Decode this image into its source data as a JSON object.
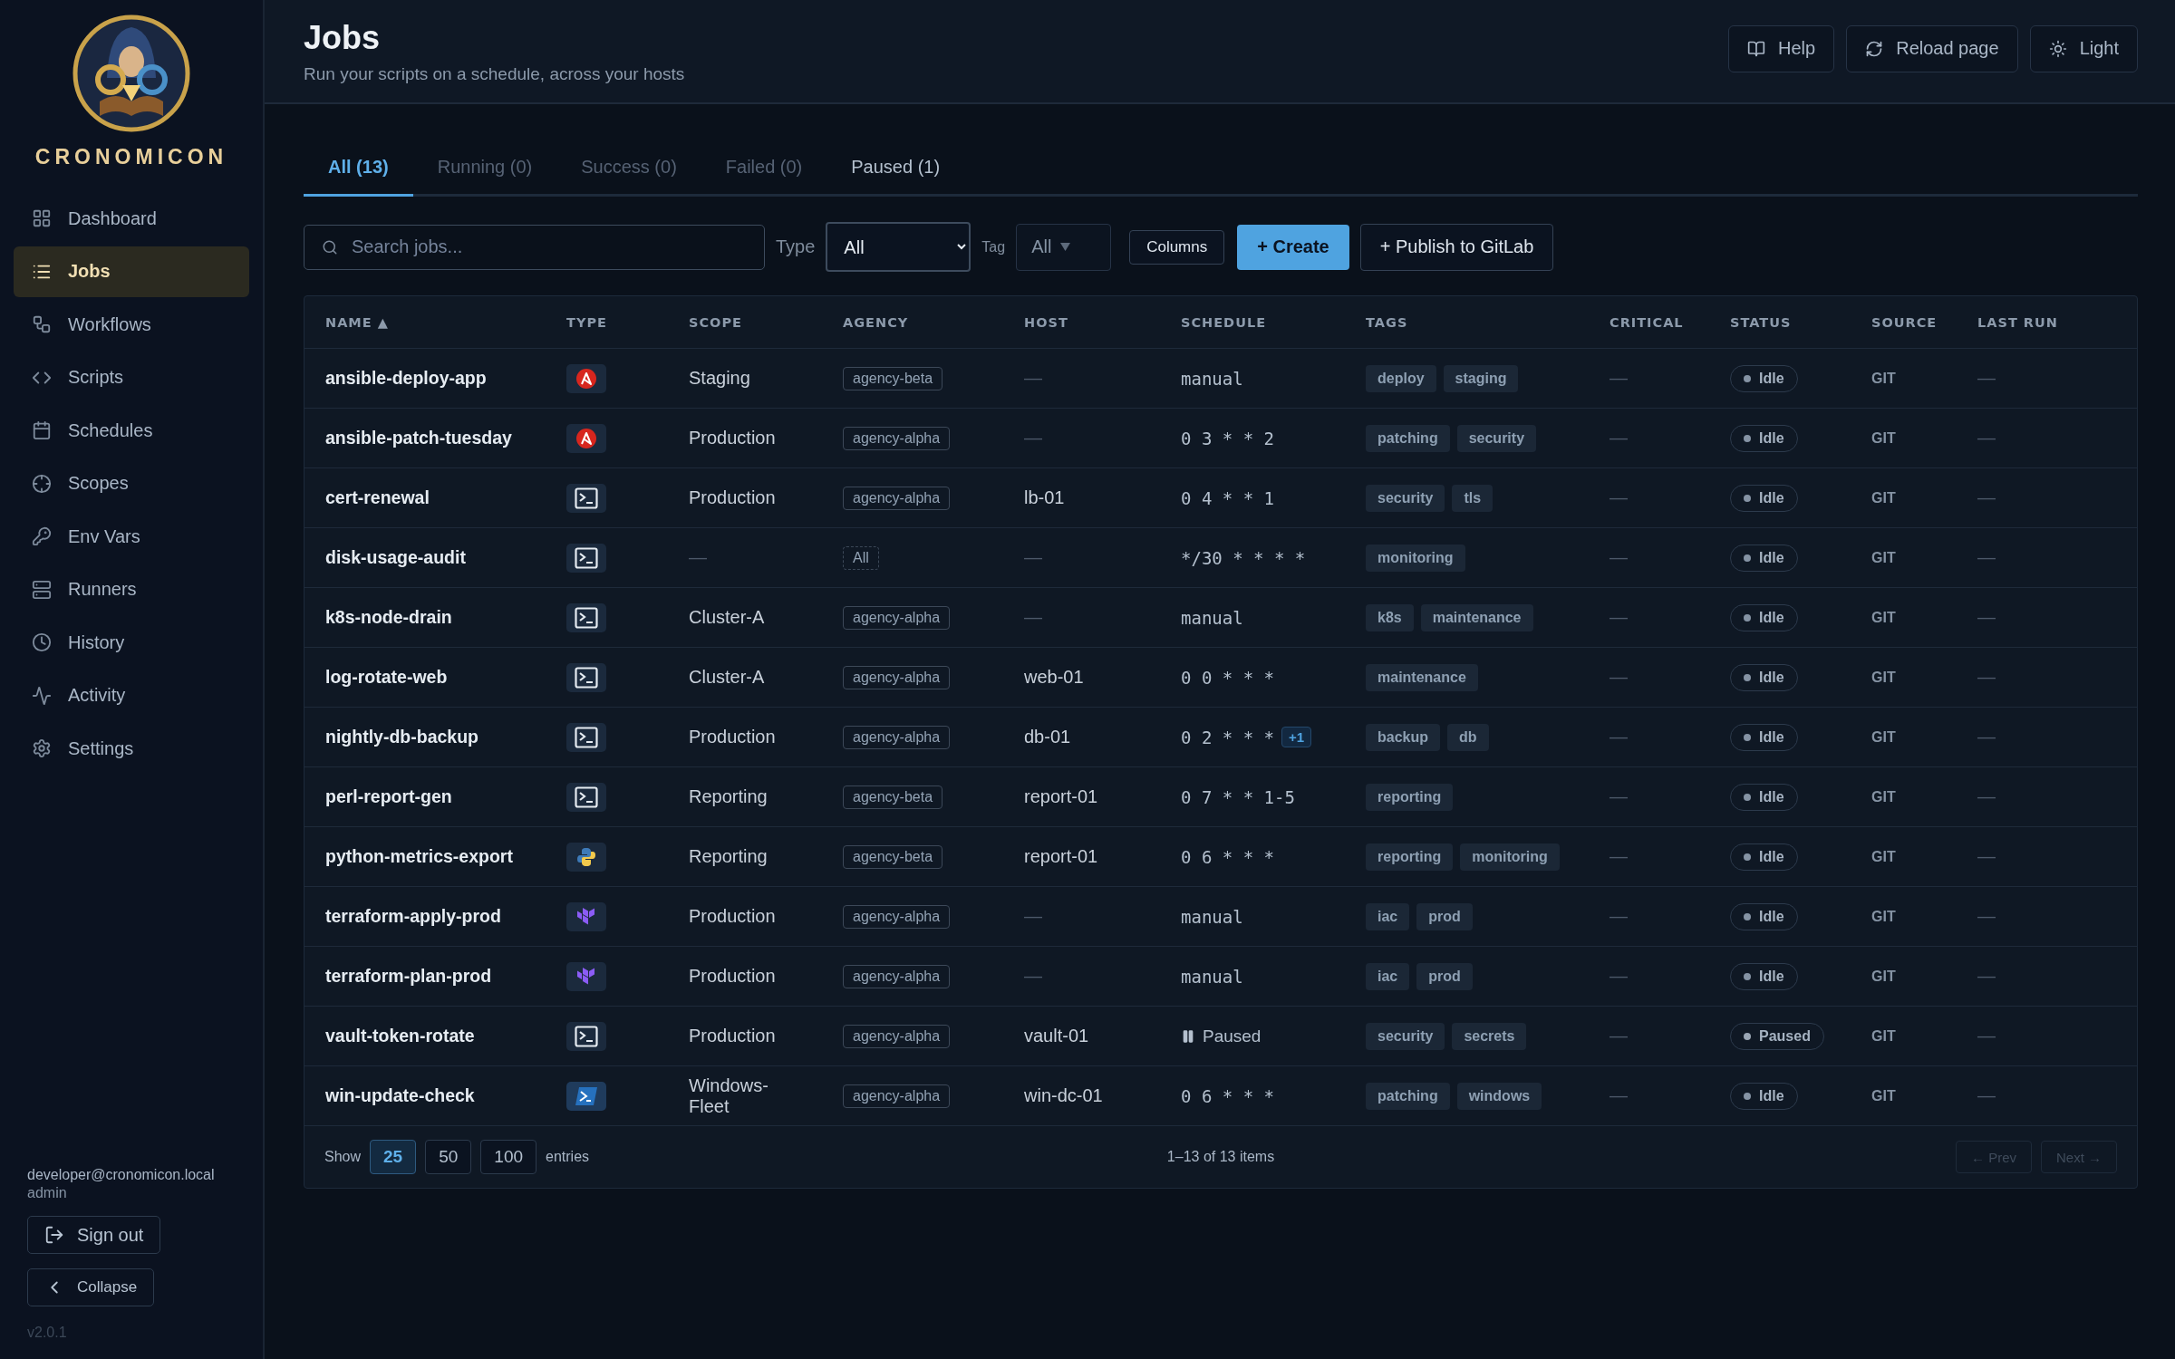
{
  "sidebar": {
    "brand": "CRONOMICON",
    "items": [
      {
        "label": "Dashboard",
        "selected": false
      },
      {
        "label": "Jobs",
        "selected": true
      },
      {
        "label": "Workflows",
        "selected": false
      },
      {
        "label": "Scripts",
        "selected": false
      },
      {
        "label": "Schedules",
        "selected": false
      },
      {
        "label": "Scopes",
        "selected": false
      },
      {
        "label": "Env Vars",
        "selected": false
      },
      {
        "label": "Runners",
        "selected": false
      },
      {
        "label": "History",
        "selected": false
      },
      {
        "label": "Activity",
        "selected": false
      },
      {
        "label": "Settings",
        "selected": false
      }
    ],
    "user": {
      "email": "developer@cronomicon.local",
      "role": "admin"
    },
    "sign_out": "Sign out",
    "collapse": "Collapse",
    "version": "v2.0.1"
  },
  "header": {
    "title": "Jobs",
    "subtitle": "Run your scripts on a schedule, across your hosts",
    "buttons": [
      "Help",
      "Reload page",
      "Light"
    ]
  },
  "tabs": [
    {
      "label": "All (13)",
      "selected": true,
      "disabled": false
    },
    {
      "label": "Running (0)",
      "selected": false,
      "disabled": true
    },
    {
      "label": "Success (0)",
      "selected": false,
      "disabled": true
    },
    {
      "label": "Failed (0)",
      "selected": false,
      "disabled": true
    },
    {
      "label": "Paused (1)",
      "selected": false,
      "disabled": false
    }
  ],
  "filters": {
    "search_placeholder": "Search jobs...",
    "type_label": "Type",
    "type_value": "All",
    "tag_label": "Tag",
    "tag_value": "All",
    "buttons": [
      {
        "label": "Columns",
        "kind": "small"
      },
      {
        "label": "+ Create",
        "kind": "primary"
      },
      {
        "label": "+ Publish to GitLab",
        "kind": "outline"
      }
    ]
  },
  "table": {
    "columns": [
      "NAME ▲",
      "TYPE",
      "SCOPE",
      "AGENCY",
      "HOST",
      "SCHEDULE",
      "TAGS",
      "CRITICAL",
      "STATUS",
      "SOURCE",
      "LAST RUN"
    ],
    "rows": [
      {
        "name": "ansible-deploy-app",
        "kind": "ansible",
        "scope": "Staging",
        "agency": {
          "label": "agency-beta",
          "kind": "named"
        },
        "host": "—",
        "schedule": {
          "text": "manual",
          "kind": "cron"
        },
        "tags": [
          "deploy",
          "staging"
        ],
        "critical": "—",
        "status": {
          "label": "Idle",
          "kind": "idle"
        },
        "source": "GIT",
        "last_run": "—"
      },
      {
        "name": "ansible-patch-tuesday",
        "kind": "ansible",
        "scope": "Production",
        "agency": {
          "label": "agency-alpha",
          "kind": "named"
        },
        "host": "—",
        "schedule": {
          "text": "0 3 * * 2",
          "kind": "cron"
        },
        "tags": [
          "patching",
          "security"
        ],
        "critical": "—",
        "status": {
          "label": "Idle",
          "kind": "idle"
        },
        "source": "GIT",
        "last_run": "—"
      },
      {
        "name": "cert-renewal",
        "kind": "shell",
        "scope": "Production",
        "agency": {
          "label": "agency-alpha",
          "kind": "named"
        },
        "host": "lb-01",
        "schedule": {
          "text": "0 4 * * 1",
          "kind": "cron"
        },
        "tags": [
          "security",
          "tls"
        ],
        "critical": "—",
        "status": {
          "label": "Idle",
          "kind": "idle"
        },
        "source": "GIT",
        "last_run": "—"
      },
      {
        "name": "disk-usage-audit",
        "kind": "shell",
        "scope": "—",
        "agency": {
          "label": "All",
          "kind": "all"
        },
        "host": "—",
        "schedule": {
          "text": "*/30 * * * *",
          "kind": "cron"
        },
        "tags": [
          "monitoring"
        ],
        "critical": "—",
        "status": {
          "label": "Idle",
          "kind": "idle"
        },
        "source": "GIT",
        "last_run": "—"
      },
      {
        "name": "k8s-node-drain",
        "kind": "shell",
        "scope": "Cluster-A",
        "agency": {
          "label": "agency-alpha",
          "kind": "named"
        },
        "host": "—",
        "schedule": {
          "text": "manual",
          "kind": "cron"
        },
        "tags": [
          "k8s",
          "maintenance"
        ],
        "critical": "—",
        "status": {
          "label": "Idle",
          "kind": "idle"
        },
        "source": "GIT",
        "last_run": "—"
      },
      {
        "name": "log-rotate-web",
        "kind": "shell",
        "scope": "Cluster-A",
        "agency": {
          "label": "agency-alpha",
          "kind": "named"
        },
        "host": "web-01",
        "schedule": {
          "text": "0 0 * * *",
          "kind": "cron"
        },
        "tags": [
          "maintenance"
        ],
        "critical": "—",
        "status": {
          "label": "Idle",
          "kind": "idle"
        },
        "source": "GIT",
        "last_run": "—"
      },
      {
        "name": "nightly-db-backup",
        "kind": "shell",
        "scope": "Production",
        "agency": {
          "label": "agency-alpha",
          "kind": "named"
        },
        "host": "db-01",
        "schedule": {
          "text": "0 2 * * *",
          "kind": "cron",
          "extra": "+1"
        },
        "tags": [
          "backup",
          "db"
        ],
        "critical": "—",
        "status": {
          "label": "Idle",
          "kind": "idle"
        },
        "source": "GIT",
        "last_run": "—"
      },
      {
        "name": "perl-report-gen",
        "kind": "shell",
        "scope": "Reporting",
        "agency": {
          "label": "agency-beta",
          "kind": "named"
        },
        "host": "report-01",
        "schedule": {
          "text": "0 7 * * 1-5",
          "kind": "cron"
        },
        "tags": [
          "reporting"
        ],
        "critical": "—",
        "status": {
          "label": "Idle",
          "kind": "idle"
        },
        "source": "GIT",
        "last_run": "—"
      },
      {
        "name": "python-metrics-export",
        "kind": "python",
        "scope": "Reporting",
        "agency": {
          "label": "agency-beta",
          "kind": "named"
        },
        "host": "report-01",
        "schedule": {
          "text": "0 6 * * *",
          "kind": "cron"
        },
        "tags": [
          "reporting",
          "monitoring"
        ],
        "critical": "—",
        "status": {
          "label": "Idle",
          "kind": "idle"
        },
        "source": "GIT",
        "last_run": "—"
      },
      {
        "name": "terraform-apply-prod",
        "kind": "terraform",
        "scope": "Production",
        "agency": {
          "label": "agency-alpha",
          "kind": "named"
        },
        "host": "—",
        "schedule": {
          "text": "manual",
          "kind": "cron"
        },
        "tags": [
          "iac",
          "prod"
        ],
        "critical": "—",
        "status": {
          "label": "Idle",
          "kind": "idle"
        },
        "source": "GIT",
        "last_run": "—"
      },
      {
        "name": "terraform-plan-prod",
        "kind": "terraform",
        "scope": "Production",
        "agency": {
          "label": "agency-alpha",
          "kind": "named"
        },
        "host": "—",
        "schedule": {
          "text": "manual",
          "kind": "cron"
        },
        "tags": [
          "iac",
          "prod"
        ],
        "critical": "—",
        "status": {
          "label": "Idle",
          "kind": "idle"
        },
        "source": "GIT",
        "last_run": "—"
      },
      {
        "name": "vault-token-rotate",
        "kind": "shell",
        "scope": "Production",
        "agency": {
          "label": "agency-alpha",
          "kind": "named"
        },
        "host": "vault-01",
        "schedule": {
          "text": "Paused",
          "kind": "paused"
        },
        "tags": [
          "security",
          "secrets"
        ],
        "critical": "—",
        "status": {
          "label": "Paused",
          "kind": "paused"
        },
        "source": "GIT",
        "last_run": "—"
      },
      {
        "name": "win-update-check",
        "kind": "powershell",
        "scope": "Windows-Fleet",
        "agency": {
          "label": "agency-alpha",
          "kind": "named"
        },
        "host": "win-dc-01",
        "schedule": {
          "text": "0 6 * * *",
          "kind": "cron"
        },
        "tags": [
          "patching",
          "windows"
        ],
        "critical": "—",
        "status": {
          "label": "Idle",
          "kind": "idle"
        },
        "source": "GIT",
        "last_run": "—"
      }
    ]
  },
  "footer": {
    "show_label": "Show",
    "page_sizes": [
      {
        "label": "25",
        "selected": true
      },
      {
        "label": "50",
        "selected": false
      },
      {
        "label": "100",
        "selected": false
      }
    ],
    "entries_label": "entries",
    "summary": "1–13 of 13 items",
    "prev": "← Prev",
    "next": "Next →"
  }
}
